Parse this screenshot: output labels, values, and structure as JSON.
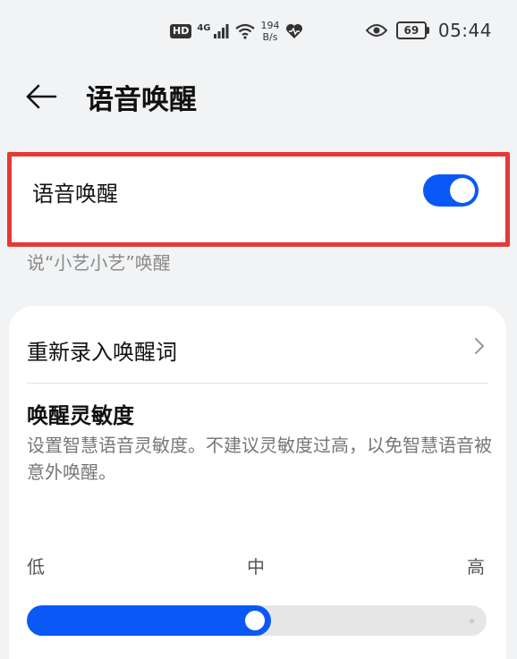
{
  "status_bar": {
    "hd": "HD",
    "network": "4G",
    "speed_value": "194",
    "speed_unit": "B/s",
    "battery": "69",
    "time": "05:44"
  },
  "header": {
    "title": "语音唤醒",
    "back_icon": "arrow-left-icon"
  },
  "wake_card": {
    "label": "语音唤醒",
    "enabled": true,
    "hint": "说“小艺小艺”唤醒",
    "accent": "#0a59f7",
    "highlight_color": "#e53935"
  },
  "settings": {
    "rerecord_label": "重新录入唤醒词",
    "sensitivity_title": "唤醒灵敏度",
    "sensitivity_desc": "设置智慧语音灵敏度。不建议灵敏度过高，以免智慧语音被意外唤醒。",
    "levels": [
      "低",
      "中",
      "高"
    ],
    "slider_value": "中",
    "slider_fraction": 0.5
  }
}
